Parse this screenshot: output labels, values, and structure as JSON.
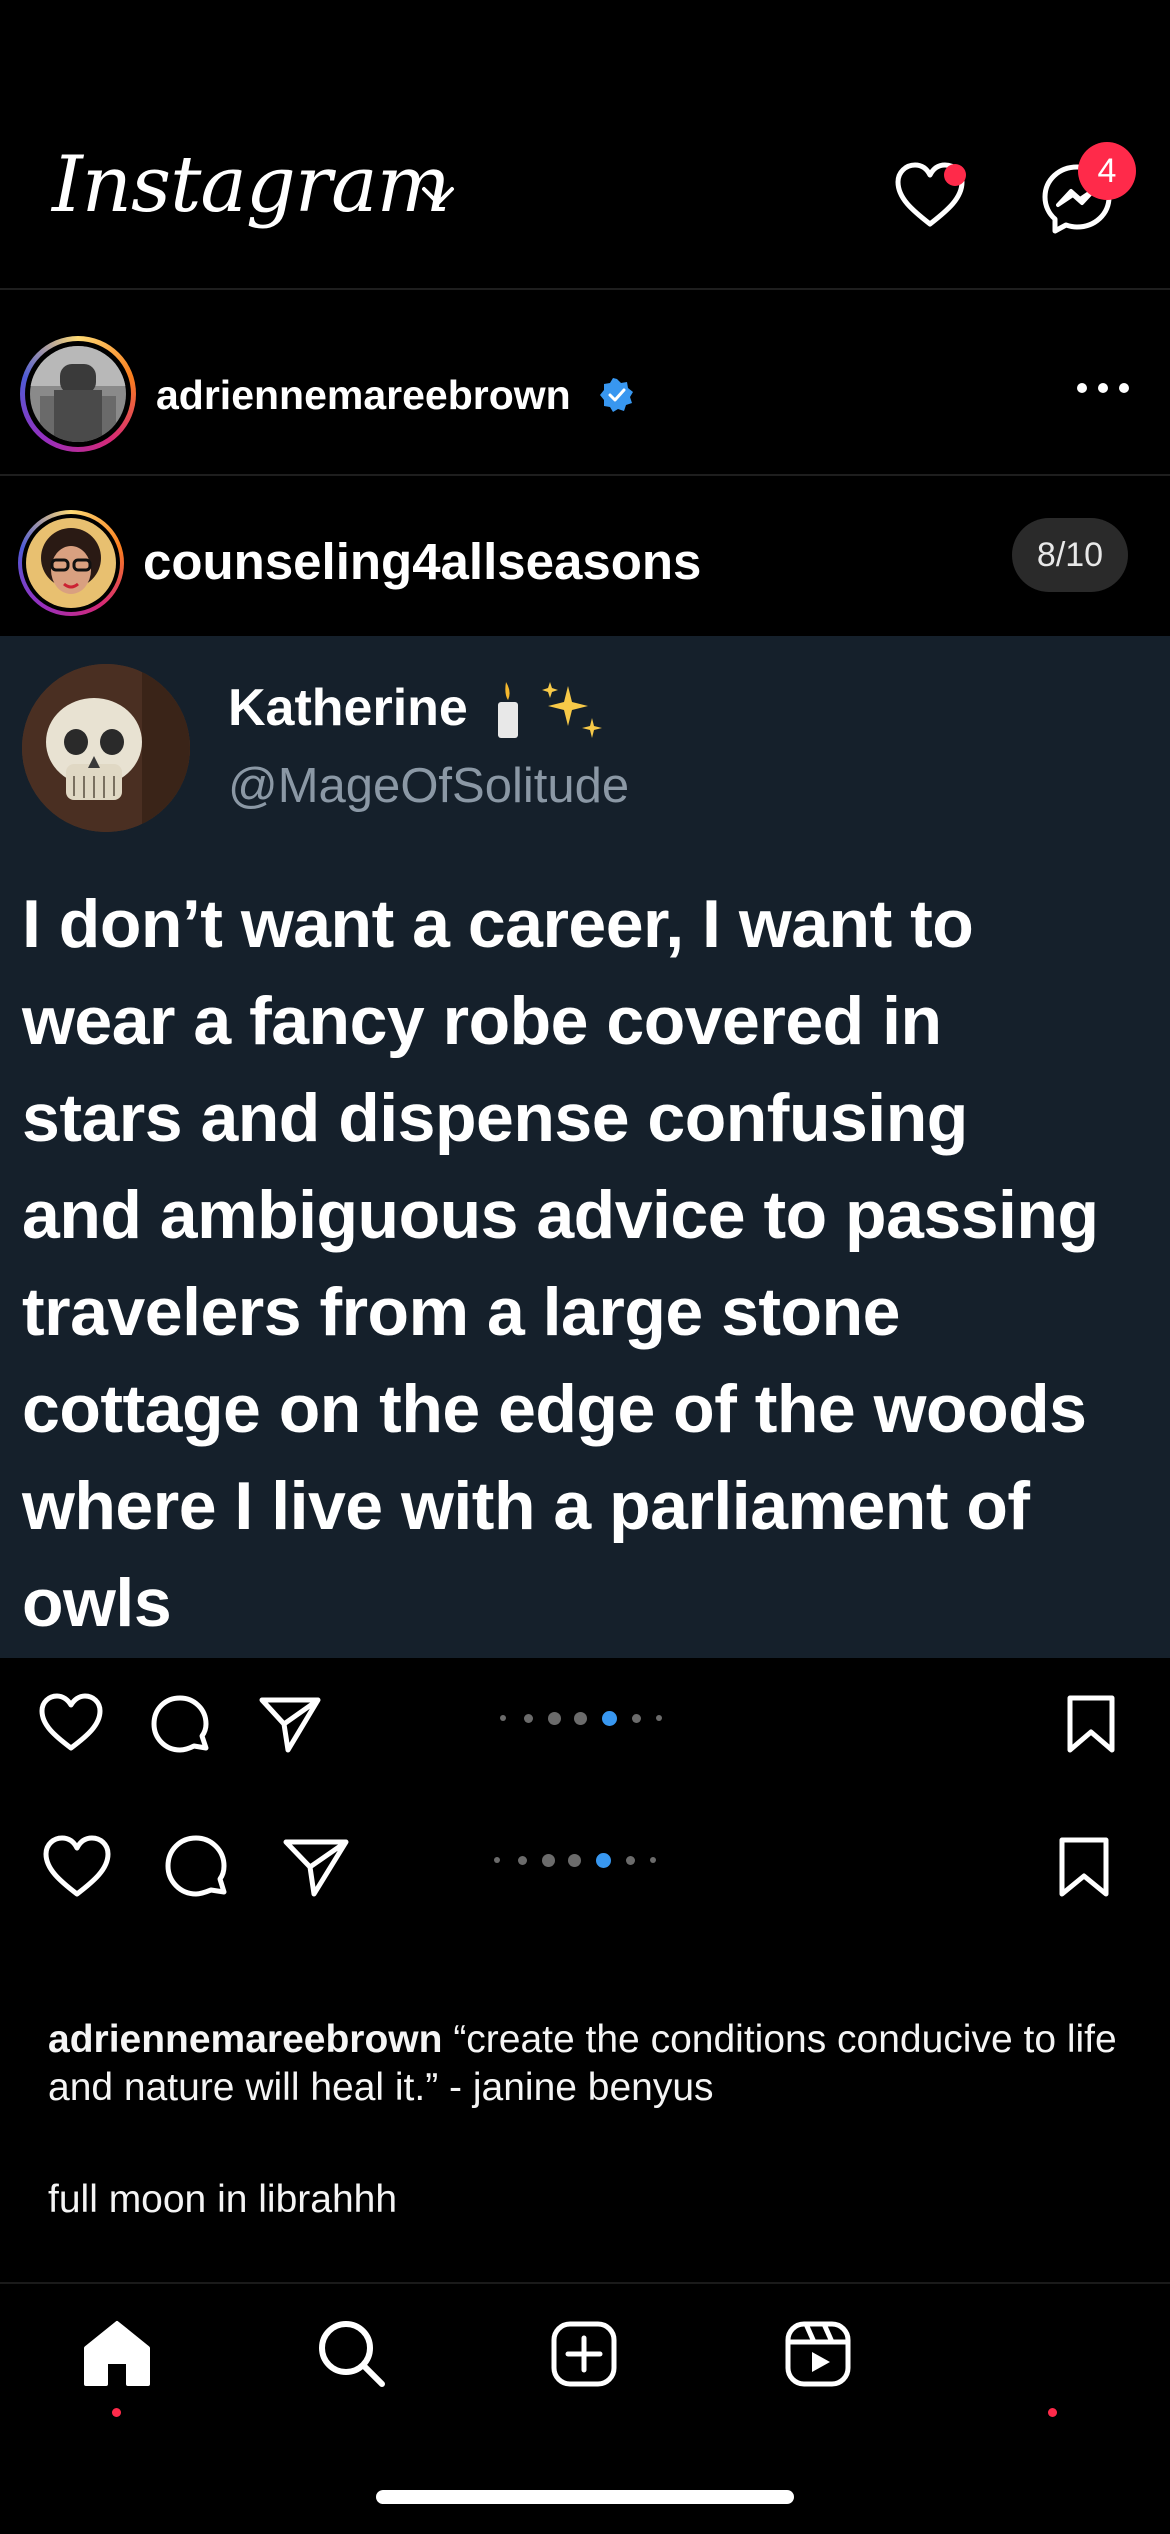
{
  "header": {
    "logo_text": "Instagram",
    "notifications_badge": true,
    "messages_count": "4"
  },
  "post_author": {
    "username": "adriennemareebrown",
    "verified": true
  },
  "reshared_post": {
    "username": "counseling4allseasons",
    "slide_counter": "8/10"
  },
  "tweet": {
    "name": "Katherine",
    "handle": "@MageOfSolitude",
    "lines": [
      "I don’t want a career, I want to",
      "wear a fancy robe covered in",
      "stars and dispense confusing",
      "and ambiguous advice to passing",
      "travelers from a large stone",
      "cottage on the edge of the woods",
      "where I live with a parliament of",
      "owls"
    ]
  },
  "carousel": {
    "active_index": 4,
    "dot_count": 7
  },
  "caption": {
    "username": "adriennemareebrown",
    "text": "“create the conditions conducive to life and nature will heal it.” - janine benyus",
    "extra_line": "full moon in librahhh"
  },
  "colors": {
    "background": "#000000",
    "tweet_background": "#15202b",
    "accent_blue": "#3897f0",
    "badge_red": "#ff2a4a"
  }
}
